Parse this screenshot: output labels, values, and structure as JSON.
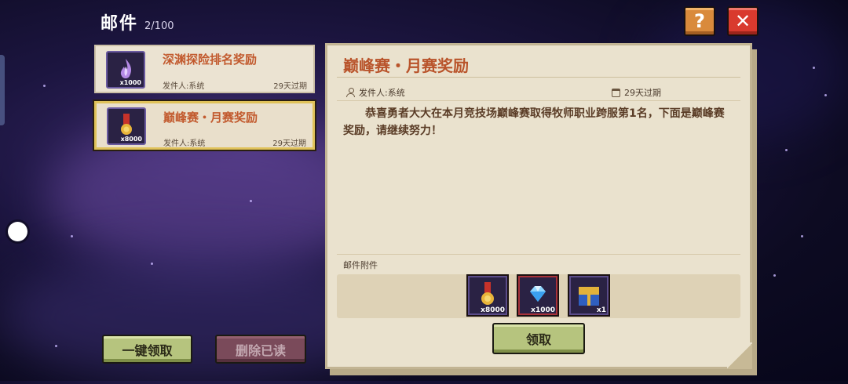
{
  "header": {
    "title": "邮件",
    "count": "2/100"
  },
  "top_buttons": {
    "help_label": "?",
    "close_label": "✕"
  },
  "mail_list": [
    {
      "title": "深渊探险排名奖励",
      "sender": "发件人:系统",
      "expire": "29天过期",
      "item_qty": "x1000",
      "item_icon": "purple-flame-icon",
      "selected": false
    },
    {
      "title": "巅峰赛・月赛奖励",
      "sender": "发件人:系统",
      "expire": "29天过期",
      "item_qty": "x8000",
      "item_icon": "medal-icon",
      "selected": true
    }
  ],
  "detail": {
    "title": "巅峰赛・月赛奖励",
    "sender": "发件人:系统",
    "expire": "29天过期",
    "body": "恭喜勇者大大在本月竞技场巅峰赛取得牧师职业跨服第1名，下面是巅峰赛奖励，请继续努力！",
    "attachments_label": "邮件附件",
    "attachments": [
      {
        "icon": "medal-icon",
        "qty": "x8000"
      },
      {
        "icon": "diamond-icon",
        "qty": "x1000"
      },
      {
        "icon": "chest-icon",
        "qty": "x1"
      }
    ],
    "claim_label": "领取"
  },
  "footer": {
    "claim_all_label": "一键领取",
    "delete_read_label": "删除已读"
  }
}
